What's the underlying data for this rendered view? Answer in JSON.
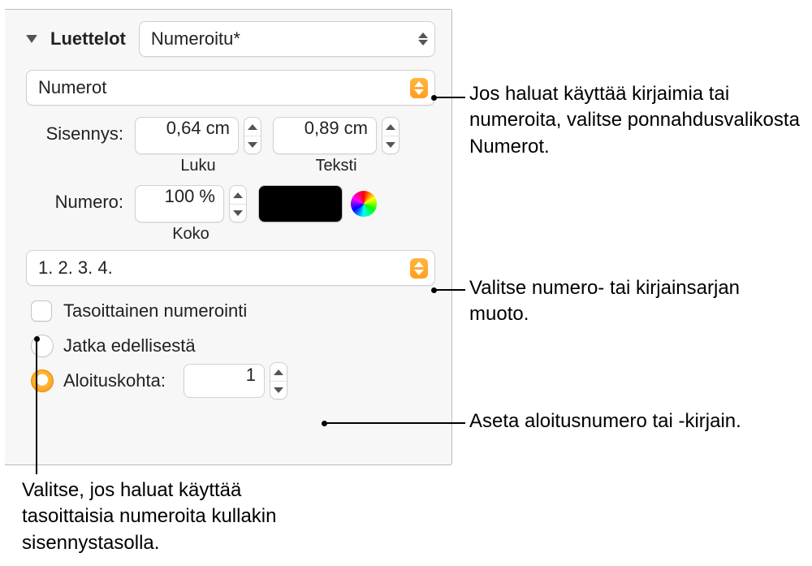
{
  "section": {
    "title": "Luettelot"
  },
  "listStyle": {
    "value": "Numeroitu*"
  },
  "numberType": {
    "value": "Numerot"
  },
  "indent": {
    "label": "Sisennys:",
    "list": {
      "value": "0,64 cm",
      "caption": "Luku"
    },
    "text": {
      "value": "0,89 cm",
      "caption": "Teksti"
    }
  },
  "number": {
    "label": "Numero:",
    "size": {
      "value": "100 %",
      "caption": "Koko"
    }
  },
  "format": {
    "value": "1. 2. 3. 4."
  },
  "tiered": {
    "label": "Tasoittainen numerointi"
  },
  "continue": {
    "label": "Jatka edellisestä"
  },
  "startFrom": {
    "label": "Aloituskohta:",
    "value": "1"
  },
  "callouts": {
    "c1": "Jos haluat käyttää kirjaimia tai numeroita, valitse ponnahdusvalikosta Numerot.",
    "c2": "Valitse numero- tai kirjainsarjan muoto.",
    "c3": "Aseta aloitusnumero tai -kirjain.",
    "c4": "Valitse, jos haluat käyttää tasoittaisia numeroita kullakin sisennystasolla."
  }
}
